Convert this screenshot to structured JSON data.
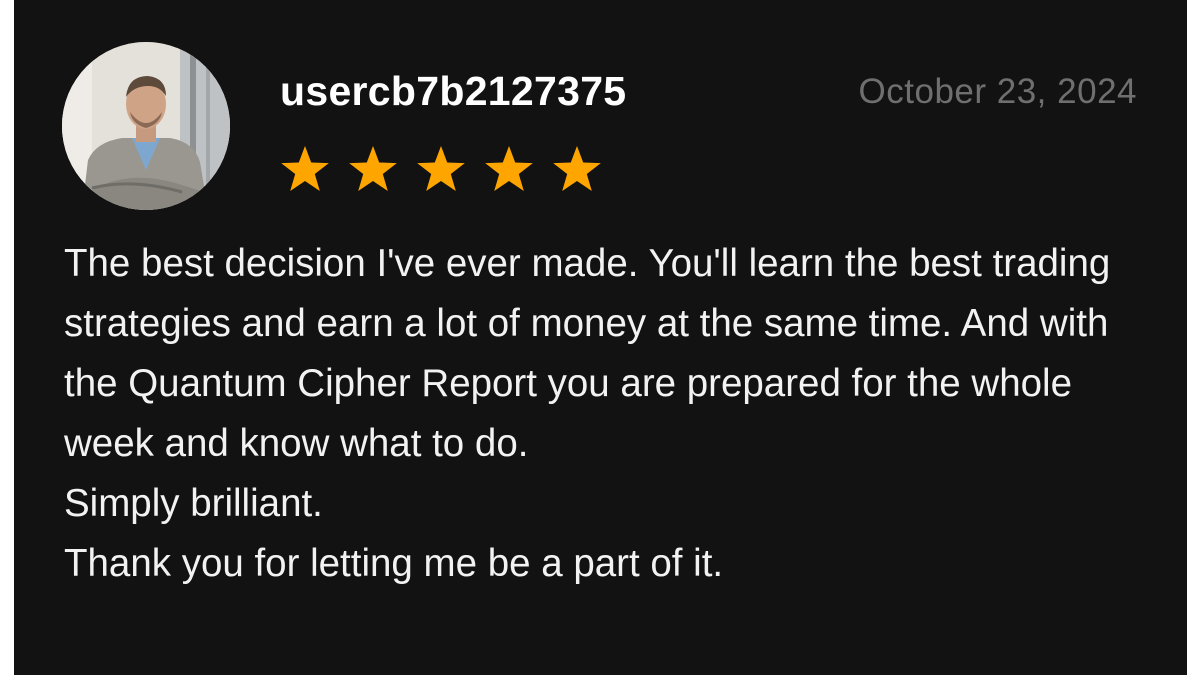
{
  "review": {
    "username": "usercb7b2127375",
    "date": "October 23, 2024",
    "rating": 5,
    "rating_max": 5,
    "star_color": "#ffa500",
    "star_icon": "star-icon",
    "avatar_icon": "user-avatar-photo",
    "body": {
      "paragraph_1": "The best decision I've ever made. You'll learn the best trading strategies and earn a lot of money at the same time. And with the Quantum Cipher Report you are prepared for the whole week and know what to do.",
      "paragraph_2": "Simply brilliant.",
      "paragraph_3": "Thank you for letting me be a part of it."
    }
  },
  "colors": {
    "background": "#121212",
    "text": "#f2f2f2",
    "date_text": "#6f6f6f"
  }
}
